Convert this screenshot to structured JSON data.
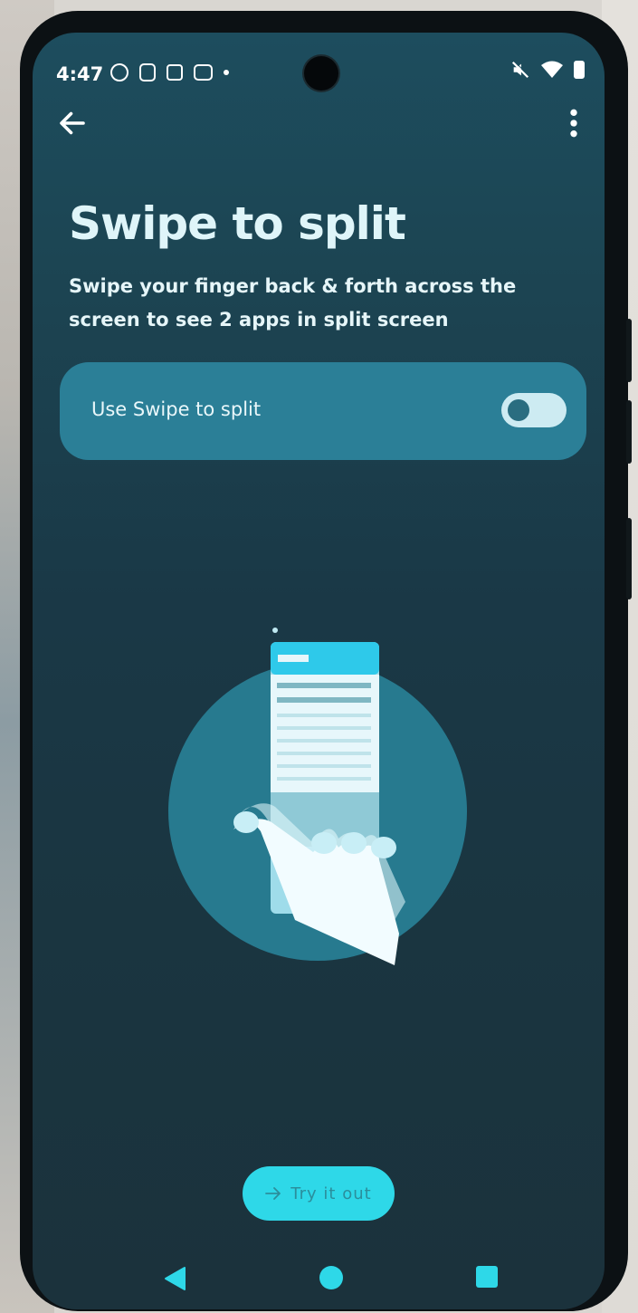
{
  "status_bar": {
    "time": "4:47",
    "left_icons": [
      "face-icon",
      "sim-icon",
      "bag-icon",
      "message-icon"
    ],
    "right_icons": [
      "mute-icon",
      "wifi-icon",
      "battery-icon"
    ]
  },
  "page": {
    "title": "Swipe to split",
    "description": "Swipe your finger back & forth across the screen to see 2 apps in split screen"
  },
  "setting": {
    "label": "Use Swipe to split",
    "enabled": false
  },
  "actions": {
    "try_label": "Try it out",
    "try_icon": "arrow-right-icon"
  },
  "colors": {
    "accent": "#2ed8e8",
    "card": "#2b7f97",
    "screen_bg": "#1a3846",
    "title_text": "#dff5f9"
  }
}
